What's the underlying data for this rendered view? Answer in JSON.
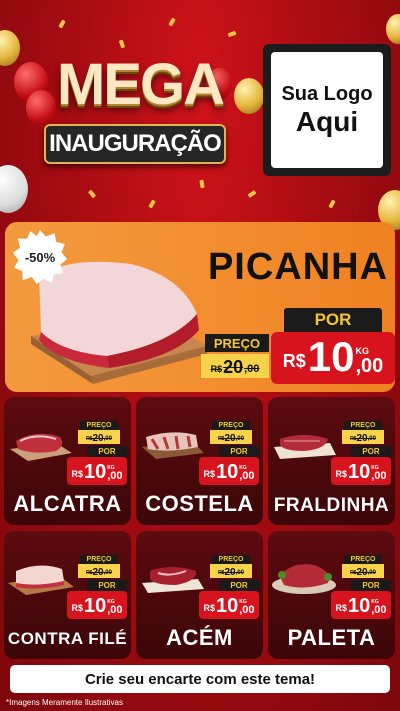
{
  "header": {
    "title_line1": "MEGA",
    "title_line2": "INAUGURAÇÃO",
    "logo_line1": "Sua Logo",
    "logo_line2": "Aqui"
  },
  "featured": {
    "discount_badge": "-50%",
    "name": "PICANHA",
    "preco_label": "PREÇO",
    "old_price_currency": "R$",
    "old_price_int": "20",
    "old_price_cents": ",00",
    "por_label": "POR",
    "new_price_currency": "R$",
    "new_price_int": "10",
    "new_price_cents": ",00",
    "unit": "KG"
  },
  "products": [
    {
      "name": "ALCATRA",
      "preco_label": "PREÇO",
      "old_currency": "R$",
      "old_int": "20",
      "old_cents": ",00",
      "por_label": "POR",
      "currency": "R$",
      "price_int": "10",
      "price_cents": ",00",
      "unit": "KG"
    },
    {
      "name": "COSTELA",
      "preco_label": "PREÇO",
      "old_currency": "R$",
      "old_int": "20",
      "old_cents": ",00",
      "por_label": "POR",
      "currency": "R$",
      "price_int": "10",
      "price_cents": ",00",
      "unit": "KG"
    },
    {
      "name": "FRALDINHA",
      "preco_label": "PREÇO",
      "old_currency": "R$",
      "old_int": "20",
      "old_cents": ",00",
      "por_label": "POR",
      "currency": "R$",
      "price_int": "10",
      "price_cents": ",00",
      "unit": "KG"
    },
    {
      "name": "CONTRA FILÉ",
      "preco_label": "PREÇO",
      "old_currency": "R$",
      "old_int": "20",
      "old_cents": ",00",
      "por_label": "POR",
      "currency": "R$",
      "price_int": "10",
      "price_cents": ",00",
      "unit": "KG"
    },
    {
      "name": "ACÉM",
      "preco_label": "PREÇO",
      "old_currency": "R$",
      "old_int": "20",
      "old_cents": ",00",
      "por_label": "POR",
      "currency": "R$",
      "price_int": "10",
      "price_cents": ",00",
      "unit": "KG"
    },
    {
      "name": "PALETA",
      "preco_label": "PREÇO",
      "old_currency": "R$",
      "old_int": "20",
      "old_cents": ",00",
      "por_label": "POR",
      "currency": "R$",
      "price_int": "10",
      "price_cents": ",00",
      "unit": "KG"
    }
  ],
  "cta_text": "Crie seu encarte com este tema!",
  "disclaimer": "*Imagens Meramente Ilustrativas",
  "colors": {
    "background": "#a70c12",
    "hero_orange": "#f28c2d",
    "price_red": "#d7141d",
    "label_black": "#1a1a1a",
    "label_gold": "#f4c531",
    "card_dark": "#4d080c"
  },
  "icons": [
    "balloon-icon",
    "confetti-icon",
    "meat-icon",
    "discount-badge-icon"
  ]
}
